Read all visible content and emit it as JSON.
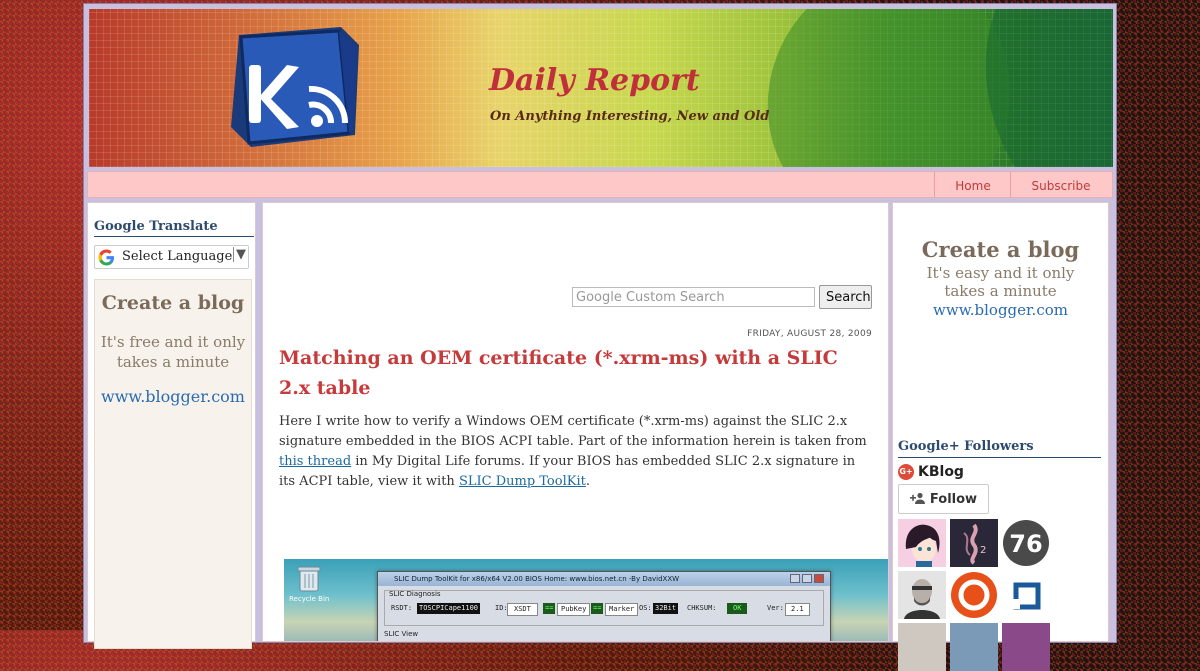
{
  "header": {
    "title": "Daily Report",
    "description": "On Anything Interesting, New and Old"
  },
  "nav": {
    "tabs": [
      {
        "label": "Home"
      },
      {
        "label": "Subscribe"
      }
    ]
  },
  "left_sidebar": {
    "translate_title": "Google Translate",
    "translate_select": "Select Language",
    "ad": {
      "heading": "Create a blog",
      "subtext": "It's free and it only takes a minute",
      "link": "www.blogger.com"
    }
  },
  "search": {
    "placeholder": "Google Custom Search",
    "button_label": "Search"
  },
  "post": {
    "date": "FRIDAY, AUGUST 28, 2009",
    "title": "Matching an OEM certificate (*.xrm-ms) with a SLIC 2.x table",
    "body_part1": "Here I write how to verify a Windows OEM certificate (*.xrm-ms) against the SLIC 2.x signature embedded in the BIOS ACPI table. Part of the information herein is taken from ",
    "link1": "this thread",
    "body_part2": " in My Digital Life forums. If your BIOS has embedded SLIC 2.x signature in its ACPI table, view it with ",
    "link2": "SLIC Dump ToolKit",
    "body_part3": "."
  },
  "screenshot": {
    "recycle_bin": "Recycle Bin",
    "window_title": "SLIC Dump ToolKit for x86/x64 V2.00    BIOS Home: www.bios.net.cn  -By DavidXXW",
    "group_label": "SLIC Diagnosis",
    "rsdt_label": "RSDT:",
    "rsdt_value": "TOSCPICape1100",
    "id_label": "ID:",
    "id_value": "XSDT",
    "ok1": "==",
    "pubkey": "PubKey",
    "ok2": "==",
    "marker": "Marker",
    "os_label": "OS:",
    "os_value": "32Bit",
    "chksum_label": "CHKSUM:",
    "chksum_value": "OK",
    "ver_label": "Ver:",
    "ver_value": "2.1",
    "view_label": "SLIC View"
  },
  "right_sidebar": {
    "ad": {
      "heading": "Create a blog",
      "subtext_line1": "It's easy and it only",
      "subtext_line2": "takes a minute",
      "link": "www.blogger.com"
    },
    "followers_title": "Google+ Followers",
    "gplus_badge": "G+",
    "profile_name": "KBlog",
    "follow_label": "Follow",
    "avatar_76_label": "76"
  },
  "colors": {
    "title_red": "#c0303a",
    "post_title_red": "#c53a3a",
    "nav_pink": "#ffc8c8",
    "link_blue": "#2a6ab0",
    "widget_title_navy": "#2c4a6e"
  }
}
